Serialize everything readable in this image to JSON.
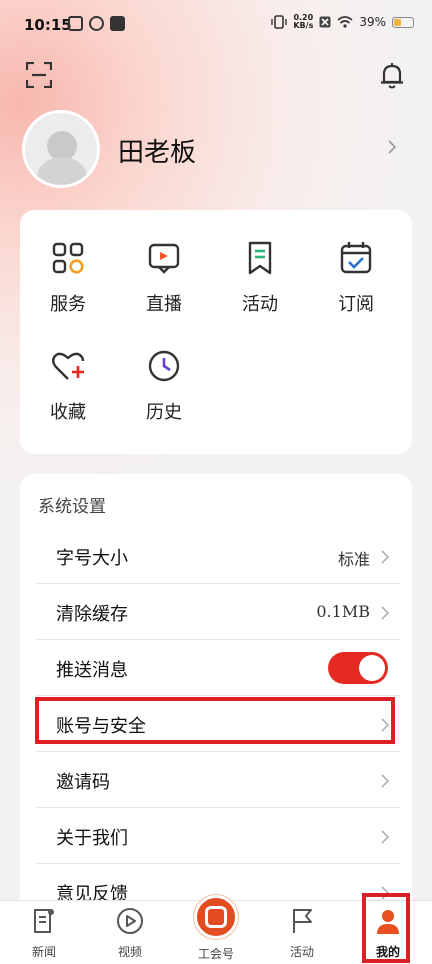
{
  "status": {
    "time": "10:15",
    "net_speed_top": "0.20",
    "net_speed_bottom": "KB/s",
    "battery": "39%",
    "battery_level": 0.39
  },
  "profile": {
    "name": "田老板"
  },
  "shortcuts": [
    {
      "label": "服务",
      "icon": "grid-apps-icon"
    },
    {
      "label": "直播",
      "icon": "live-tv-icon"
    },
    {
      "label": "活动",
      "icon": "bookmark-icon"
    },
    {
      "label": "订阅",
      "icon": "calendar-check-icon"
    },
    {
      "label": "收藏",
      "icon": "heart-plus-icon"
    },
    {
      "label": "历史",
      "icon": "clock-icon"
    }
  ],
  "settings": {
    "title": "系统设置",
    "rows": [
      {
        "label": "字号大小",
        "value": "标准"
      },
      {
        "label": "清除缓存",
        "value": "0.1MB"
      },
      {
        "label": "推送消息",
        "toggle": true
      },
      {
        "label": "账号与安全",
        "value": ""
      },
      {
        "label": "邀请码",
        "value": ""
      },
      {
        "label": "关于我们",
        "value": ""
      },
      {
        "label": "意见反馈",
        "value": ""
      }
    ]
  },
  "nav": {
    "items": [
      {
        "label": "新闻",
        "icon": "news-icon"
      },
      {
        "label": "视频",
        "icon": "play-circle-icon"
      },
      {
        "label": "工会号",
        "icon": "union-logo-icon"
      },
      {
        "label": "活动",
        "icon": "flag-icon"
      },
      {
        "label": "我的",
        "icon": "person-icon"
      }
    ]
  },
  "colors": {
    "accent": "#e52a22",
    "highlight": "#dc2126",
    "blue": "#2b6fd6",
    "green": "#2bb37a",
    "orange": "#f0a020"
  }
}
